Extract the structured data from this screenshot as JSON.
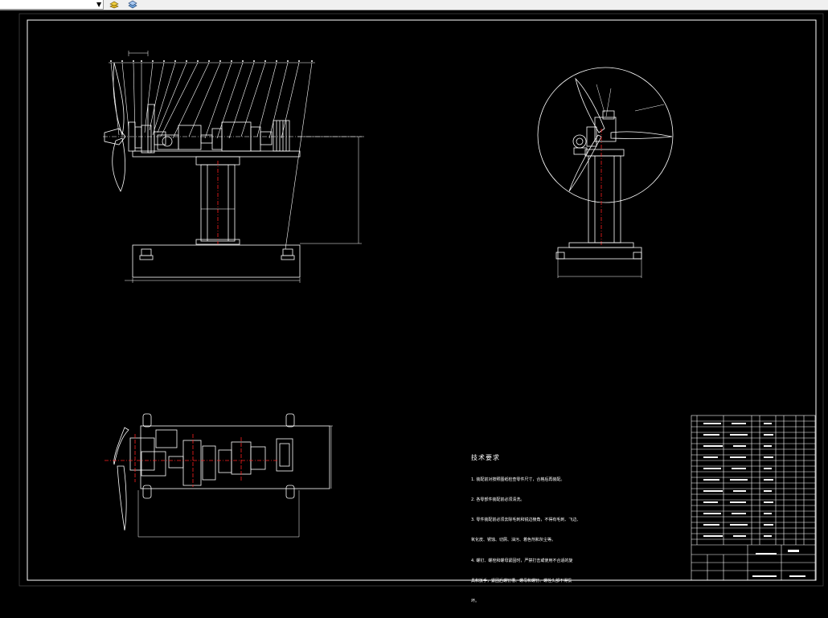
{
  "toolbar": {
    "dropdown_value": "",
    "icons": [
      "layer-state-icon",
      "layer-props-icon"
    ]
  },
  "drawing": {
    "background": "#000000",
    "line_color": "#ffffff",
    "centerline_color": "#ff2020",
    "tech_notes": {
      "title": "技术要求",
      "lines": [
        "1. 装配前对按照图纸检查零件尺寸，合格后再装配。",
        "2. 各零部件装配前必须清洗。",
        "3. 零件装配前必须去除毛刺和锐边棱角，不得有毛刺、飞边、",
        "氧化皮、锈蚀、切屑、油污、着色剂和灰尘等。",
        "4. 螺钉、螺栓和螺母紧固时，严禁打击或使用不合适的旋",
        "具和扳手，紧固后螺钉槽、螺母和螺钉、螺栓头部不得损",
        "坏。"
      ]
    }
  }
}
